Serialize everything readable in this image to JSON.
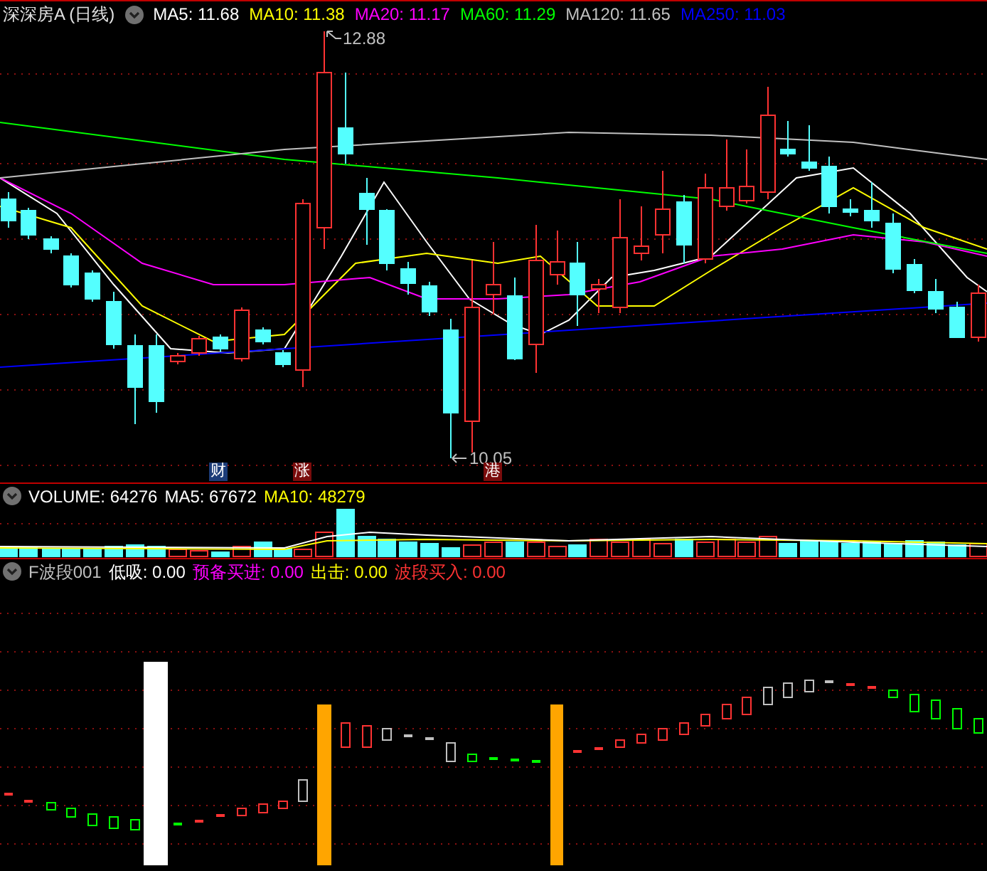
{
  "main_header": {
    "title": "深深房A (日线)",
    "indicators": [
      {
        "label": "MA5: 11.68",
        "color": "#ffffff"
      },
      {
        "label": "MA10: 11.38",
        "color": "#ffff00"
      },
      {
        "label": "MA20: 11.17",
        "color": "#ff00ff"
      },
      {
        "label": "MA60: 11.29",
        "color": "#00ff00"
      },
      {
        "label": "MA120: 11.65",
        "color": "#c0c0c0"
      },
      {
        "label": "MA250: 11.03",
        "color": "#0000ff"
      }
    ]
  },
  "price_labels": {
    "high": "12.88",
    "low": "10.05"
  },
  "event_badges": [
    {
      "label": "财",
      "color": "#1c3c78"
    },
    {
      "label": "涨",
      "color": "#7a0c0c"
    },
    {
      "label": "港",
      "color": "#7a0c0c"
    }
  ],
  "volume_header": {
    "indicators": [
      {
        "label": "VOLUME: 64276",
        "color": "#ffffff"
      },
      {
        "label": "MA5: 67672",
        "color": "#ffffff"
      },
      {
        "label": "MA10: 48279",
        "color": "#ffff00"
      }
    ]
  },
  "indicator_header": {
    "title": "F波段001",
    "indicators": [
      {
        "label": "低吸: 0.00",
        "color": "#ffffff"
      },
      {
        "label": "预备买进: 0.00",
        "color": "#ff00ff"
      },
      {
        "label": "出击: 0.00",
        "color": "#ffff00"
      },
      {
        "label": "波段买入: 0.00",
        "color": "#ff3333"
      }
    ]
  }
}
